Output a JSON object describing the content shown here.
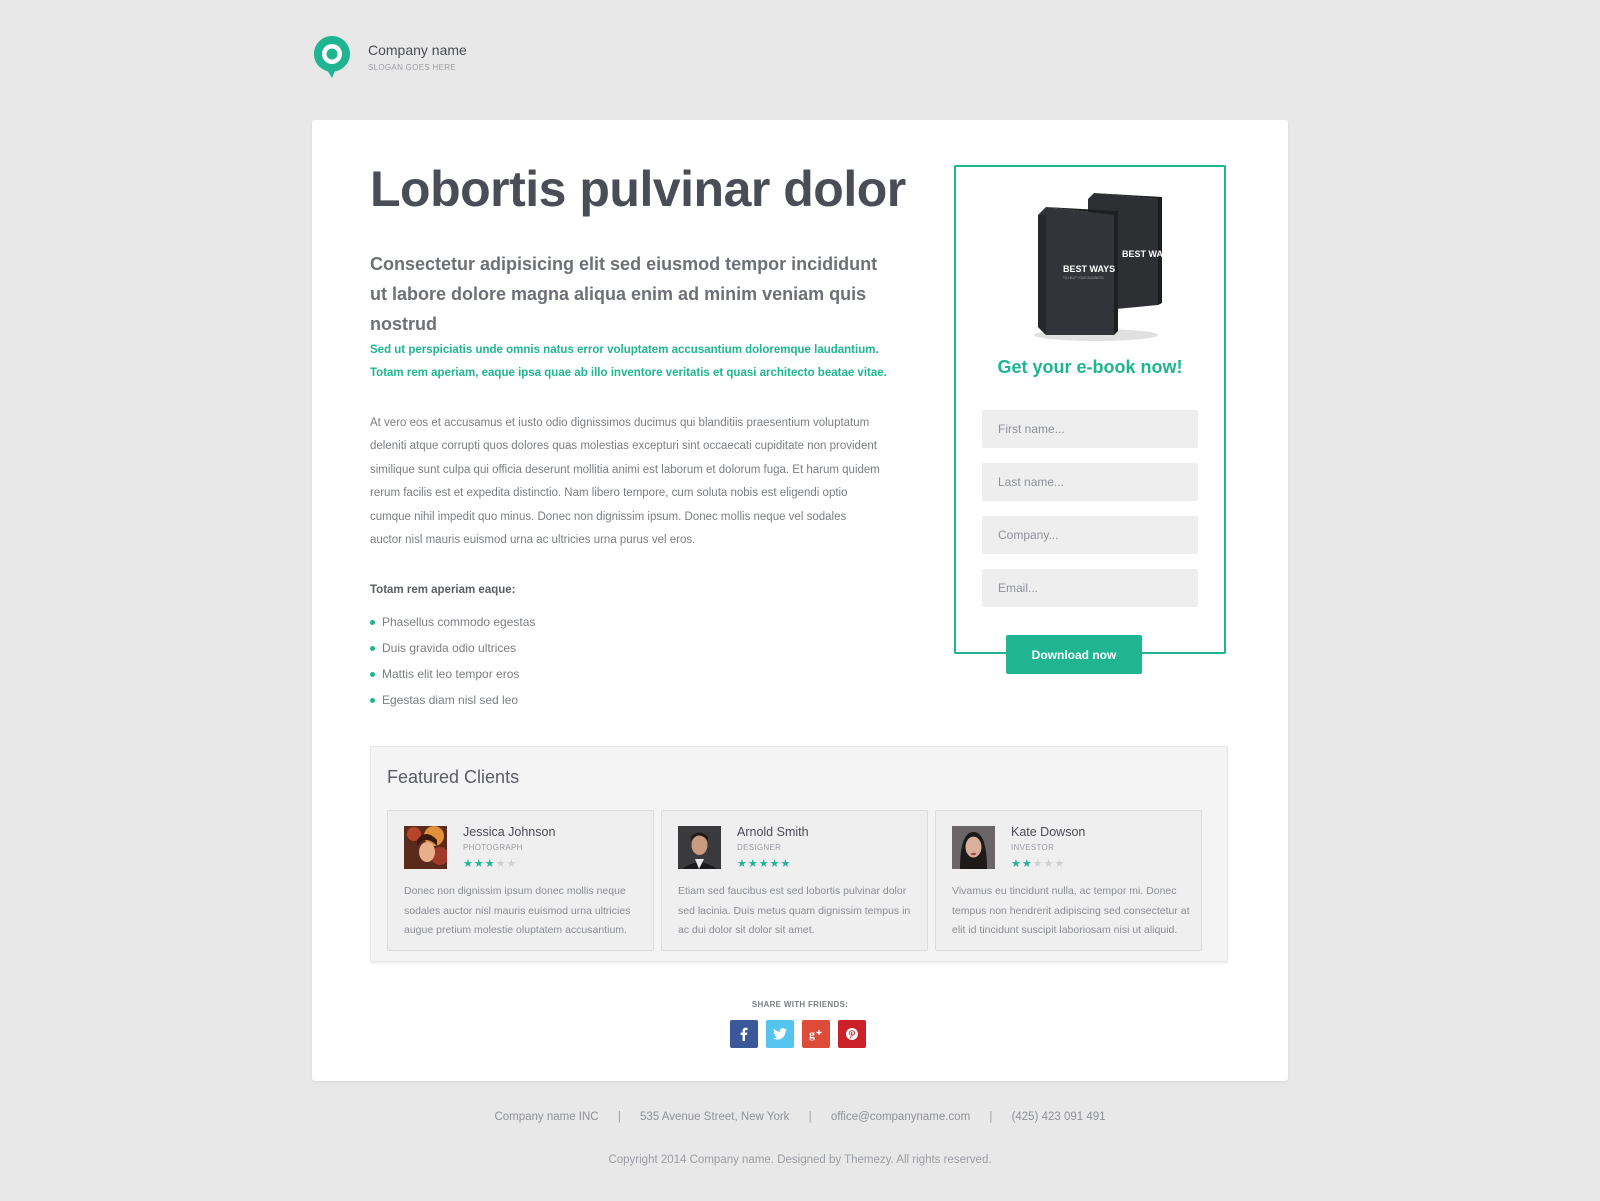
{
  "header": {
    "brand_name": "Company name",
    "slogan": "SLOGAN GOES HERE",
    "logo_icon": "location-pin-icon"
  },
  "main": {
    "title": "Lobortis pulvinar dolor",
    "subtitle": "Consectetur adipisicing elit sed eiusmod tempor incididunt ut labore dolore magna aliqua enim ad minim veniam quis nostrud",
    "accent_paragraph": "Sed ut perspiciatis unde omnis natus error voluptatem accusantium doloremque laudantium. Totam rem aperiam, eaque ipsa quae ab illo inventore veritatis et quasi architecto beatae vitae.",
    "body_paragraph": "At vero eos et accusamus et iusto odio dignissimos ducimus qui blanditiis praesentium voluptatum deleniti atque corrupti quos dolores quas molestias excepturi sint occaecati cupiditate non provident similique sunt culpa qui officia deserunt mollitia animi est laborum et dolorum fuga. Et harum quidem rerum facilis est et expedita distinctio. Nam libero tempore, cum soluta nobis est eligendi optio cumque nihil impedit quo minus. Donec non dignissim ipsum. Donec mollis neque vel sodales auctor nisl mauris euismod urna ac ultricies urna purus vel eros.",
    "list_heading": "Totam rem aperiam eaque:",
    "list_items": [
      "Phasellus commodo egestas",
      "Duis gravida odio ultrices",
      "Mattis elit leo tempor eros",
      "Egestas diam nisl sed leo"
    ]
  },
  "ebook": {
    "book_title": "BEST WAYS",
    "book_subtitle": "TO HELP YOUR BUSINESS",
    "form_title": "Get your e-book now!",
    "fields": {
      "first_name": "First name...",
      "last_name": "Last name...",
      "company": "Company...",
      "email": "Email..."
    },
    "button_label": "Download now"
  },
  "clients": {
    "title": "Featured Clients",
    "items": [
      {
        "name": "Jessica Johnson",
        "role": "PHOTOGRAPH",
        "rating": 3,
        "max_rating": 5,
        "quote": "Donec non dignissim ipsum donec mollis neque sodales auctor nisl mauris euismod urna ultricies augue pretium molestie oluptatem accusantium."
      },
      {
        "name": "Arnold Smith",
        "role": "DESIGNER",
        "rating": 5,
        "max_rating": 5,
        "quote": "Etiam sed faucibus est sed lobortis pulvinar dolor sed lacinia. Duis metus quam dignissim tempus in ac dui dolor sit dolor sit amet."
      },
      {
        "name": "Kate Dowson",
        "role": "INVESTOR",
        "rating": 2,
        "max_rating": 5,
        "quote": "Vivamus eu tincidunt nulla, ac tempor mi. Donec tempus non hendrerit adipiscing sed consectetur at elit id tincidunt suscipit laboriosam nisi ut aliquid."
      }
    ]
  },
  "share": {
    "label": "SHARE WITH FRIENDS:",
    "buttons": [
      {
        "name": "facebook",
        "glyph": "f",
        "color": "#3b5998"
      },
      {
        "name": "twitter",
        "glyph": "twitter-bird",
        "color": "#55c4ef"
      },
      {
        "name": "google-plus",
        "glyph": "g+",
        "color": "#dd4b39"
      },
      {
        "name": "pinterest",
        "glyph": "p",
        "color": "#cb2027"
      }
    ]
  },
  "footer": {
    "company": "Company name INC",
    "address": "535 Avenue Street, New York",
    "email": "office@companyname.com",
    "phone": "(425) 423 091 491",
    "separator": "|",
    "copyright": "Copyright 2014 Company name. Designed by Themezy. All rights reserved."
  },
  "colors": {
    "accent": "#1fb591",
    "background": "#e8e8e8",
    "card": "#ffffff",
    "heading": "#4a4d55"
  }
}
